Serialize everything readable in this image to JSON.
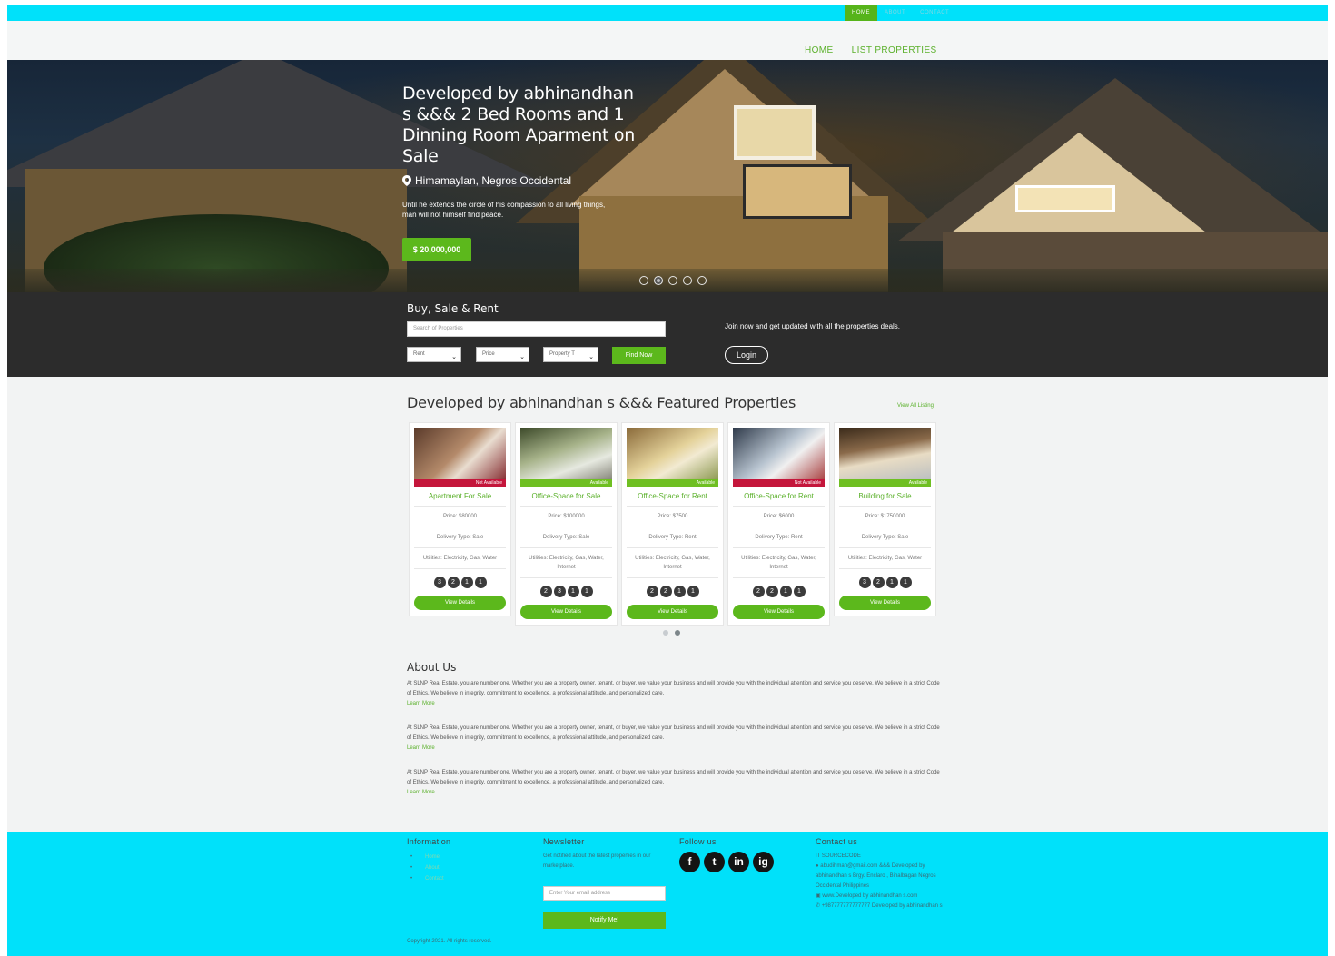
{
  "topbar": {
    "nav": [
      "HOME",
      "ABOUT",
      "CONTACT"
    ]
  },
  "mainnav": {
    "items": [
      "HOME",
      "LIST PROPERTIES"
    ]
  },
  "hero": {
    "title": "Developed by abhinandhan s &&& 2 Bed Rooms and 1 Dinning Room Aparment on Sale",
    "location": "Himamaylan, Negros Occidental",
    "description": "Until he extends the circle of his compassion to all living things, man will not himself find peace.",
    "price": "$ 20,000,000",
    "slides": 5,
    "active_slide": 2
  },
  "search": {
    "title": "Buy, Sale & Rent",
    "placeholder": "Search of Properties",
    "selects": [
      "Rent",
      "Price",
      "Property T"
    ],
    "find_label": "Find Now",
    "join_text": "Join now and get updated with all the properties deals.",
    "login_label": "Login"
  },
  "featured": {
    "title": "Developed by abhinandhan s &&& Featured Properties",
    "view_all": "View All Listing",
    "cards": [
      {
        "status": "Not Available",
        "title": "Apartment For Sale",
        "price": "Price: $80000",
        "delivery": "Delivery Type: Sale",
        "utilities": "Utilities: Electricity, Gas, Water",
        "counts": [
          "3",
          "2",
          "1",
          "1"
        ],
        "button": "View Details"
      },
      {
        "status": "Available",
        "title": "Office-Space for Sale",
        "price": "Price: $100000",
        "delivery": "Delivery Type: Sale",
        "utilities": "Utilities: Electricity, Gas, Water, Internet",
        "counts": [
          "2",
          "3",
          "1",
          "1"
        ],
        "button": "View Details"
      },
      {
        "status": "Available",
        "title": "Office-Space for Rent",
        "price": "Price: $7500",
        "delivery": "Delivery Type: Rent",
        "utilities": "Utilities: Electricity, Gas, Water, Internet",
        "counts": [
          "2",
          "2",
          "1",
          "1"
        ],
        "button": "View Details"
      },
      {
        "status": "Not Available",
        "title": "Office-Space for Rent",
        "price": "Price: $6000",
        "delivery": "Delivery Type: Rent",
        "utilities": "Utilities: Electricity, Gas, Water, Internet",
        "counts": [
          "2",
          "2",
          "1",
          "1"
        ],
        "button": "View Details"
      },
      {
        "status": "Available",
        "title": "Building for Sale",
        "price": "Price: $1750000",
        "delivery": "Delivery Type: Sale",
        "utilities": "Utilities: Electricity, Gas, Water",
        "counts": [
          "3",
          "2",
          "1",
          "1"
        ],
        "button": "View Details"
      }
    ]
  },
  "about": {
    "title": "About Us",
    "paragraph": "At SLNP Real Estate, you are number one. Whether you are a property owner, tenant, or buyer, we value your business and will provide you with the individual attention and service you deserve. We believe in a strict Code of Ethics. We believe in integrity, commitment to excellence, a professional attitude, and personalized care.",
    "learn_more": "Learn More"
  },
  "footer": {
    "info_title": "Information",
    "info_links": [
      "Home",
      "About",
      "Contact"
    ],
    "newsletter_title": "Newsletter",
    "newsletter_text": "Get notified about the latest properties in our marketplace.",
    "email_placeholder": "Enter Your email address",
    "notify_label": "Notify Me!",
    "follow_title": "Follow us",
    "social": [
      "f",
      "t",
      "in",
      "ig"
    ],
    "contact_title": "Contact us",
    "contact_name": "IT SOURCECODE",
    "contact_email": "abudihman@gmail.com &&& Developed by abhinandhan s Brgy. Enclaro , Binalbagan Negros Occidental Philippines",
    "contact_web": "www.Developed by abhinandhan s.com",
    "contact_phone": "+987777777777777 Developed by abhinandhan s",
    "copyright": "Copyright 2021. All rights reserved."
  },
  "colors": {
    "accent": "#5cb81c",
    "topbar": "#00e1fa",
    "dark": "#2c2c2c",
    "not_available": "#c4163b"
  }
}
